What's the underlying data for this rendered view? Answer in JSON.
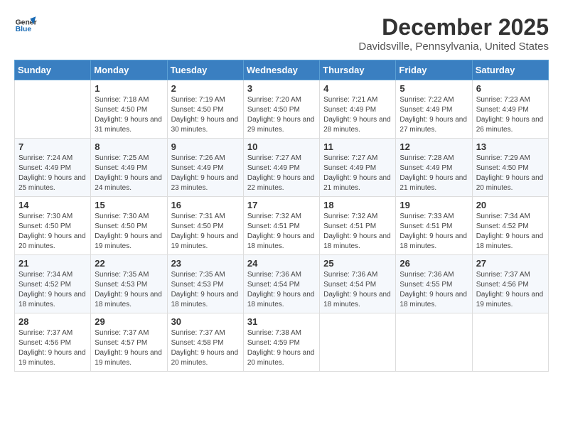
{
  "header": {
    "logo_general": "General",
    "logo_blue": "Blue",
    "month": "December 2025",
    "location": "Davidsville, Pennsylvania, United States"
  },
  "days_of_week": [
    "Sunday",
    "Monday",
    "Tuesday",
    "Wednesday",
    "Thursday",
    "Friday",
    "Saturday"
  ],
  "weeks": [
    [
      {
        "day": "",
        "sunrise": "",
        "sunset": "",
        "daylight": ""
      },
      {
        "day": "1",
        "sunrise": "Sunrise: 7:18 AM",
        "sunset": "Sunset: 4:50 PM",
        "daylight": "Daylight: 9 hours and 31 minutes."
      },
      {
        "day": "2",
        "sunrise": "Sunrise: 7:19 AM",
        "sunset": "Sunset: 4:50 PM",
        "daylight": "Daylight: 9 hours and 30 minutes."
      },
      {
        "day": "3",
        "sunrise": "Sunrise: 7:20 AM",
        "sunset": "Sunset: 4:50 PM",
        "daylight": "Daylight: 9 hours and 29 minutes."
      },
      {
        "day": "4",
        "sunrise": "Sunrise: 7:21 AM",
        "sunset": "Sunset: 4:49 PM",
        "daylight": "Daylight: 9 hours and 28 minutes."
      },
      {
        "day": "5",
        "sunrise": "Sunrise: 7:22 AM",
        "sunset": "Sunset: 4:49 PM",
        "daylight": "Daylight: 9 hours and 27 minutes."
      },
      {
        "day": "6",
        "sunrise": "Sunrise: 7:23 AM",
        "sunset": "Sunset: 4:49 PM",
        "daylight": "Daylight: 9 hours and 26 minutes."
      }
    ],
    [
      {
        "day": "7",
        "sunrise": "Sunrise: 7:24 AM",
        "sunset": "Sunset: 4:49 PM",
        "daylight": "Daylight: 9 hours and 25 minutes."
      },
      {
        "day": "8",
        "sunrise": "Sunrise: 7:25 AM",
        "sunset": "Sunset: 4:49 PM",
        "daylight": "Daylight: 9 hours and 24 minutes."
      },
      {
        "day": "9",
        "sunrise": "Sunrise: 7:26 AM",
        "sunset": "Sunset: 4:49 PM",
        "daylight": "Daylight: 9 hours and 23 minutes."
      },
      {
        "day": "10",
        "sunrise": "Sunrise: 7:27 AM",
        "sunset": "Sunset: 4:49 PM",
        "daylight": "Daylight: 9 hours and 22 minutes."
      },
      {
        "day": "11",
        "sunrise": "Sunrise: 7:27 AM",
        "sunset": "Sunset: 4:49 PM",
        "daylight": "Daylight: 9 hours and 21 minutes."
      },
      {
        "day": "12",
        "sunrise": "Sunrise: 7:28 AM",
        "sunset": "Sunset: 4:49 PM",
        "daylight": "Daylight: 9 hours and 21 minutes."
      },
      {
        "day": "13",
        "sunrise": "Sunrise: 7:29 AM",
        "sunset": "Sunset: 4:50 PM",
        "daylight": "Daylight: 9 hours and 20 minutes."
      }
    ],
    [
      {
        "day": "14",
        "sunrise": "Sunrise: 7:30 AM",
        "sunset": "Sunset: 4:50 PM",
        "daylight": "Daylight: 9 hours and 20 minutes."
      },
      {
        "day": "15",
        "sunrise": "Sunrise: 7:30 AM",
        "sunset": "Sunset: 4:50 PM",
        "daylight": "Daylight: 9 hours and 19 minutes."
      },
      {
        "day": "16",
        "sunrise": "Sunrise: 7:31 AM",
        "sunset": "Sunset: 4:50 PM",
        "daylight": "Daylight: 9 hours and 19 minutes."
      },
      {
        "day": "17",
        "sunrise": "Sunrise: 7:32 AM",
        "sunset": "Sunset: 4:51 PM",
        "daylight": "Daylight: 9 hours and 18 minutes."
      },
      {
        "day": "18",
        "sunrise": "Sunrise: 7:32 AM",
        "sunset": "Sunset: 4:51 PM",
        "daylight": "Daylight: 9 hours and 18 minutes."
      },
      {
        "day": "19",
        "sunrise": "Sunrise: 7:33 AM",
        "sunset": "Sunset: 4:51 PM",
        "daylight": "Daylight: 9 hours and 18 minutes."
      },
      {
        "day": "20",
        "sunrise": "Sunrise: 7:34 AM",
        "sunset": "Sunset: 4:52 PM",
        "daylight": "Daylight: 9 hours and 18 minutes."
      }
    ],
    [
      {
        "day": "21",
        "sunrise": "Sunrise: 7:34 AM",
        "sunset": "Sunset: 4:52 PM",
        "daylight": "Daylight: 9 hours and 18 minutes."
      },
      {
        "day": "22",
        "sunrise": "Sunrise: 7:35 AM",
        "sunset": "Sunset: 4:53 PM",
        "daylight": "Daylight: 9 hours and 18 minutes."
      },
      {
        "day": "23",
        "sunrise": "Sunrise: 7:35 AM",
        "sunset": "Sunset: 4:53 PM",
        "daylight": "Daylight: 9 hours and 18 minutes."
      },
      {
        "day": "24",
        "sunrise": "Sunrise: 7:36 AM",
        "sunset": "Sunset: 4:54 PM",
        "daylight": "Daylight: 9 hours and 18 minutes."
      },
      {
        "day": "25",
        "sunrise": "Sunrise: 7:36 AM",
        "sunset": "Sunset: 4:54 PM",
        "daylight": "Daylight: 9 hours and 18 minutes."
      },
      {
        "day": "26",
        "sunrise": "Sunrise: 7:36 AM",
        "sunset": "Sunset: 4:55 PM",
        "daylight": "Daylight: 9 hours and 18 minutes."
      },
      {
        "day": "27",
        "sunrise": "Sunrise: 7:37 AM",
        "sunset": "Sunset: 4:56 PM",
        "daylight": "Daylight: 9 hours and 19 minutes."
      }
    ],
    [
      {
        "day": "28",
        "sunrise": "Sunrise: 7:37 AM",
        "sunset": "Sunset: 4:56 PM",
        "daylight": "Daylight: 9 hours and 19 minutes."
      },
      {
        "day": "29",
        "sunrise": "Sunrise: 7:37 AM",
        "sunset": "Sunset: 4:57 PM",
        "daylight": "Daylight: 9 hours and 19 minutes."
      },
      {
        "day": "30",
        "sunrise": "Sunrise: 7:37 AM",
        "sunset": "Sunset: 4:58 PM",
        "daylight": "Daylight: 9 hours and 20 minutes."
      },
      {
        "day": "31",
        "sunrise": "Sunrise: 7:38 AM",
        "sunset": "Sunset: 4:59 PM",
        "daylight": "Daylight: 9 hours and 20 minutes."
      },
      {
        "day": "",
        "sunrise": "",
        "sunset": "",
        "daylight": ""
      },
      {
        "day": "",
        "sunrise": "",
        "sunset": "",
        "daylight": ""
      },
      {
        "day": "",
        "sunrise": "",
        "sunset": "",
        "daylight": ""
      }
    ]
  ]
}
